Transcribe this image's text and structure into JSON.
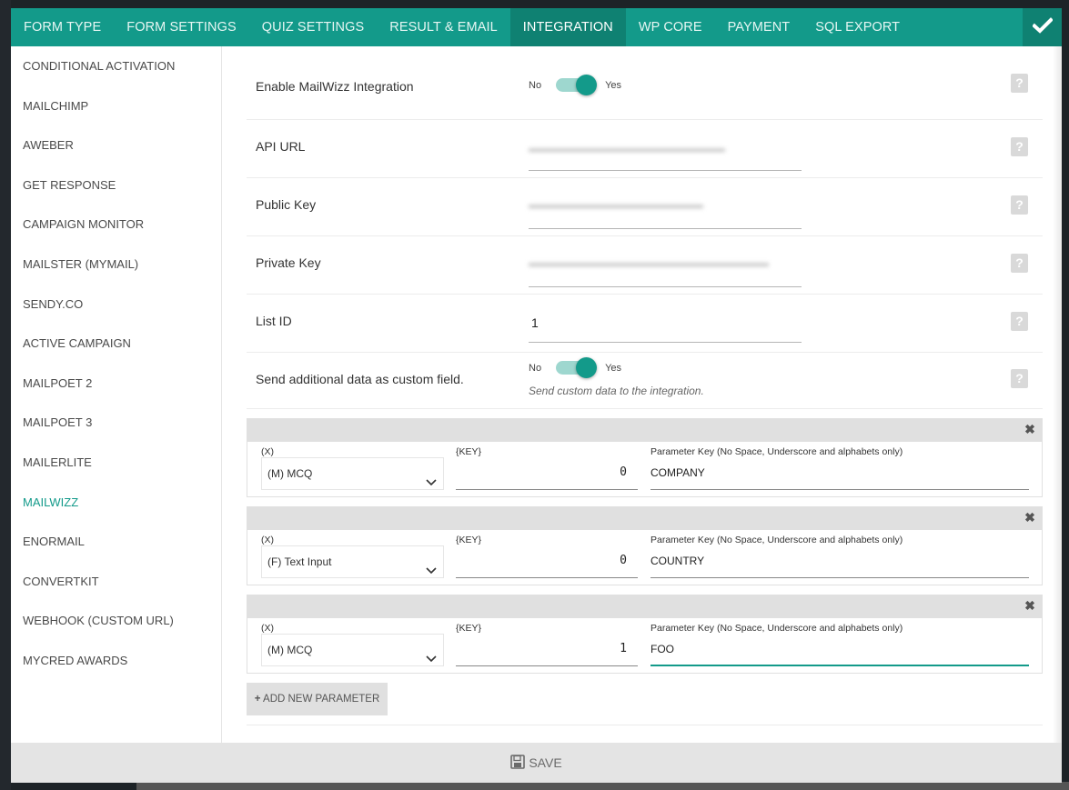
{
  "tabs": [
    "FORM TYPE",
    "FORM SETTINGS",
    "QUIZ SETTINGS",
    "RESULT & EMAIL",
    "INTEGRATION",
    "WP CORE",
    "PAYMENT",
    "SQL EXPORT"
  ],
  "active_tab": "INTEGRATION",
  "sidebar": [
    "CONDITIONAL ACTIVATION",
    "MAILCHIMP",
    "AWEBER",
    "GET RESPONSE",
    "CAMPAIGN MONITOR",
    "MAILSTER (MYMAIL)",
    "SENDY.CO",
    "ACTIVE CAMPAIGN",
    "MAILPOET 2",
    "MAILPOET 3",
    "MAILERLITE",
    "MAILWIZZ",
    "ENORMAIL",
    "CONVERTKIT",
    "WEBHOOK (CUSTOM URL)",
    "MYCRED AWARDS"
  ],
  "active_sidebar": "MAILWIZZ",
  "form": {
    "enable_label": "Enable MailWizz Integration",
    "toggle_no": "No",
    "toggle_yes": "Yes",
    "api_url_label": "API URL",
    "public_key_label": "Public Key",
    "private_key_label": "Private Key",
    "list_id_label": "List ID",
    "list_id_value": "1",
    "custom_field_label": "Send additional data as custom field.",
    "custom_field_hint": "Send custom data to the integration.",
    "help_glyph": "?"
  },
  "param_labels": {
    "x": "(X)",
    "key": "{KEY}",
    "param": "Parameter Key (No Space, Underscore and alphabets only)"
  },
  "params": [
    {
      "x": "(M) MCQ",
      "key": "0",
      "param": "COMPANY"
    },
    {
      "x": "(F) Text Input",
      "key": "0",
      "param": "COUNTRY"
    },
    {
      "x": "(M) MCQ",
      "key": "1",
      "param": "FOO"
    }
  ],
  "add_button": "ADD NEW PARAMETER",
  "save_label": "SAVE",
  "colors": {
    "accent": "#139a8a",
    "accent_dark": "#0f8172",
    "toggle_track": "#9ed7cf"
  }
}
